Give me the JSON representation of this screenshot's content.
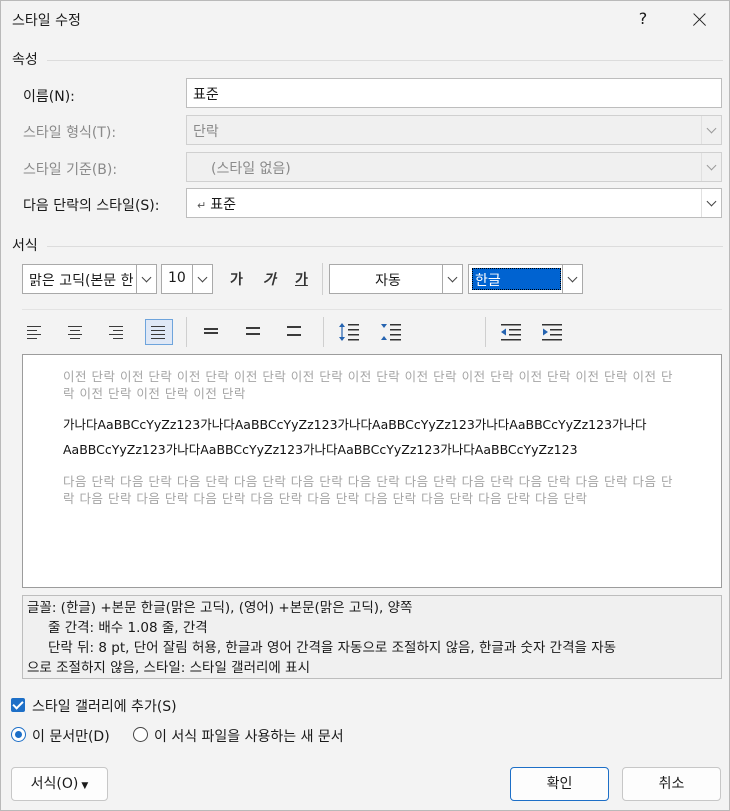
{
  "window": {
    "title": "스타일 수정",
    "help": "?"
  },
  "properties": {
    "section_title": "속성",
    "name_label": "이름(N):",
    "name_value": "표준",
    "style_type_label": "스타일 형식(T):",
    "style_type_value": "단락",
    "style_based_label": "스타일 기준(B):",
    "style_based_value": "(스타일 없음)",
    "next_style_label": "다음 단락의 스타일(S):",
    "next_style_value": "표준",
    "next_style_icon": "paragraph-return-icon"
  },
  "formatting": {
    "section_title": "서식",
    "font_name": "맑은 고딕(본문 한",
    "font_size": "10",
    "bold": "가",
    "italic": "가",
    "underline": "가",
    "color": "자동",
    "language": "한글"
  },
  "preview": {
    "prev_text": "이전 단락 이전 단락 이전 단락 이전 단락 이전 단락 이전 단락 이전 단락 이전 단락 이전 단락 이전 단락 이전 단락 이전 단락 이전 단락 이전 단락",
    "sample_line1": "가나다AaBBCcYyZz123가나다AaBBCcYyZz123가나다AaBBCcYyZz123가나다AaBBCcYyZz123가나다",
    "sample_line2": "AaBBCcYyZz123가나다AaBBCcYyZz123가나다AaBBCcYyZz123가나다AaBBCcYyZz123",
    "next_text": "다음 단락 다음 단락 다음 단락 다음 단락 다음 단락 다음 단락 다음 단락 다음 단락 다음 단락 다음 단락 다음 단락 다음 단락 다음 단락 다음 단락 다음 단락 다음 단락 다음 단락 다음 단락 다음 단락 다음 단락"
  },
  "description": {
    "line1": "글꼴: (한글) +본문 한글(맑은 고딕), (영어) +본문(맑은 고딕), 양쪽",
    "line2": "줄 간격: 배수 1.08 줄, 간격",
    "line3": "단락 뒤: 8 pt, 단어 잘림 허용, 한글과 영어 간격을 자동으로 조절하지 않음, 한글과 숫자 간격을 자동",
    "line4": "으로 조절하지 않음, 스타일: 스타일 갤러리에 표시"
  },
  "options": {
    "add_gallery": "스타일 갤러리에 추가(S)",
    "add_gallery_checked": true,
    "only_doc": "이 문서만(D)",
    "new_docs": "이 서식 파일을 사용하는 새 문서",
    "selected": "only_doc"
  },
  "buttons": {
    "format": "서식(O)",
    "ok": "확인",
    "cancel": "취소"
  },
  "colors": {
    "accent": "#1d6fc7",
    "selection": "#0063d1"
  }
}
